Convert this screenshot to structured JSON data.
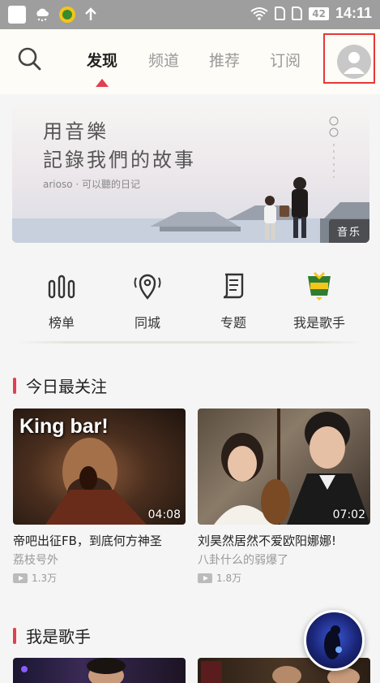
{
  "status_bar": {
    "battery": "42",
    "time": "14:11"
  },
  "nav": {
    "tabs": [
      {
        "label": "发现"
      },
      {
        "label": "频道"
      },
      {
        "label": "推荐"
      },
      {
        "label": "订阅"
      }
    ],
    "active_tab": "发现"
  },
  "banner": {
    "line1": "用音樂",
    "line2": "記錄我們的故事",
    "subtitle": "arioso · 可以聽的日记",
    "tag": "音乐"
  },
  "categories": [
    {
      "label": "榜单",
      "icon": "chart-bars-icon"
    },
    {
      "label": "同城",
      "icon": "location-pin-icon"
    },
    {
      "label": "专题",
      "icon": "scroll-icon"
    },
    {
      "label": "我是歌手",
      "icon": "singer-show-logo-icon"
    }
  ],
  "sections": [
    {
      "title": "今日最关注",
      "videos": [
        {
          "thumb_text": "King bar!",
          "duration": "04:08",
          "title": "帝吧出征FB，到底何方神圣",
          "author": "荔枝号外",
          "views": "1.3万"
        },
        {
          "thumb_text": "",
          "duration": "07:02",
          "title": "刘昊然居然不爱欧阳娜娜!",
          "author": "八卦什么的弱爆了",
          "views": "1.8万"
        }
      ]
    },
    {
      "title": "我是歌手",
      "videos": []
    }
  ],
  "colors": {
    "accent": "#e0404f",
    "status_bar": "#9e9e9e",
    "page_bg": "#fdfcf7",
    "highlight_box": "#e53935"
  }
}
